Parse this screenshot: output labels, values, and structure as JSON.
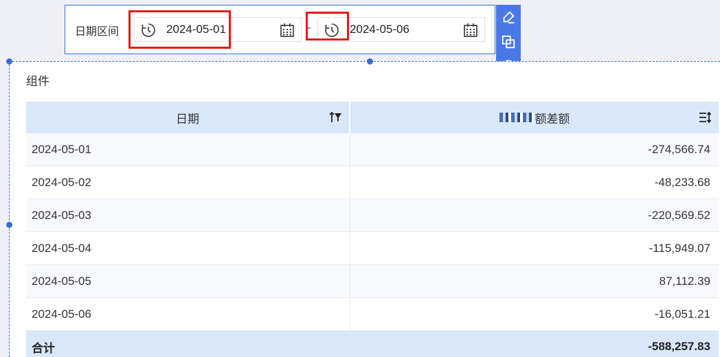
{
  "filter": {
    "label": "日期区间",
    "start_value": "2024-05-01",
    "separator": "-",
    "end_value": "2024-05-06"
  },
  "toolbar": {
    "icons": [
      "edit-icon",
      "copy-icon",
      "expand-icon"
    ]
  },
  "component": {
    "title": "组件"
  },
  "table": {
    "columns": [
      "日期",
      "额差额"
    ],
    "rows": [
      {
        "date": "2024-05-01",
        "value": "-274,566.74"
      },
      {
        "date": "2024-05-02",
        "value": "-48,233.68"
      },
      {
        "date": "2024-05-03",
        "value": "-220,569.52"
      },
      {
        "date": "2024-05-04",
        "value": "-115,949.07"
      },
      {
        "date": "2024-05-05",
        "value": "87,112.39"
      },
      {
        "date": "2024-05-06",
        "value": "-16,051.21"
      }
    ],
    "total_label": "合计",
    "total_value": "-588,257.83"
  },
  "colors": {
    "accent": "#3b6cd7",
    "toolbar": "#4a78e6",
    "header_bg": "#d9e7fb",
    "highlight": "#e01b1b"
  }
}
